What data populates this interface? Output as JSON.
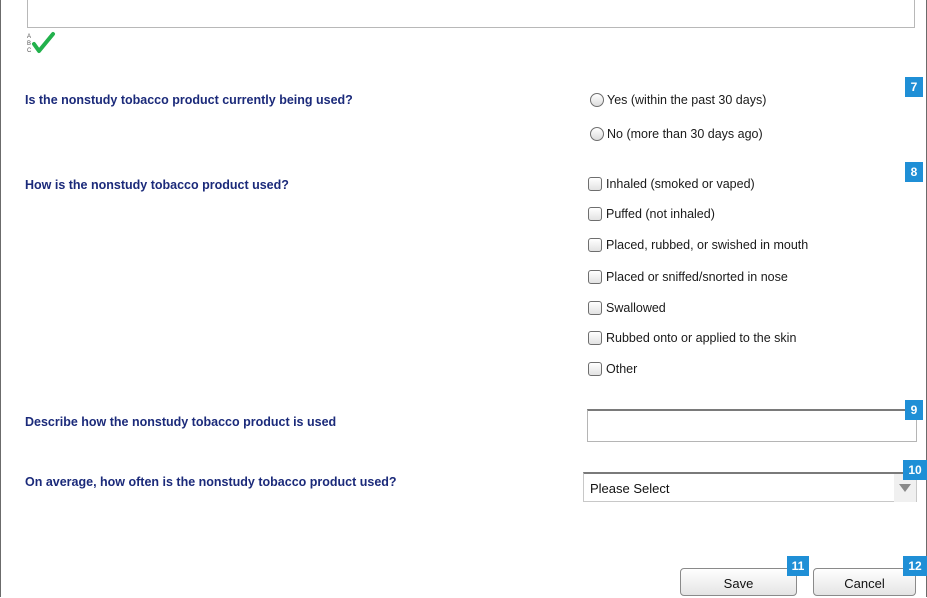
{
  "questions": {
    "q7": {
      "label": "Is the nonstudy tobacco product currently being used?",
      "badge": "7",
      "options": [
        "Yes (within the past 30 days)",
        "No (more than 30 days ago)"
      ]
    },
    "q8": {
      "label": "How is the nonstudy tobacco product used?",
      "badge": "8",
      "options": [
        "Inhaled (smoked or vaped)",
        "Puffed (not inhaled)",
        "Placed, rubbed, or swished in mouth",
        "Placed or sniffed/snorted in nose",
        "Swallowed",
        "Rubbed onto or applied to the skin",
        "Other"
      ]
    },
    "q9": {
      "label": "Describe how the nonstudy tobacco product is used",
      "badge": "9",
      "value": ""
    },
    "q10": {
      "label": "On average, how often is the nonstudy tobacco product used?",
      "badge": "10",
      "selected": "Please Select"
    }
  },
  "buttons": {
    "save": {
      "label": "Save",
      "badge": "11"
    },
    "cancel": {
      "label": "Cancel",
      "badge": "12"
    }
  },
  "colors": {
    "question_text": "#1b2a7a",
    "badge_bg": "#1f8fd6",
    "check_green": "#22b14c"
  },
  "icons": {
    "spellcheck": "spellcheck-icon",
    "dropdown": "dropdown-arrow-icon"
  }
}
